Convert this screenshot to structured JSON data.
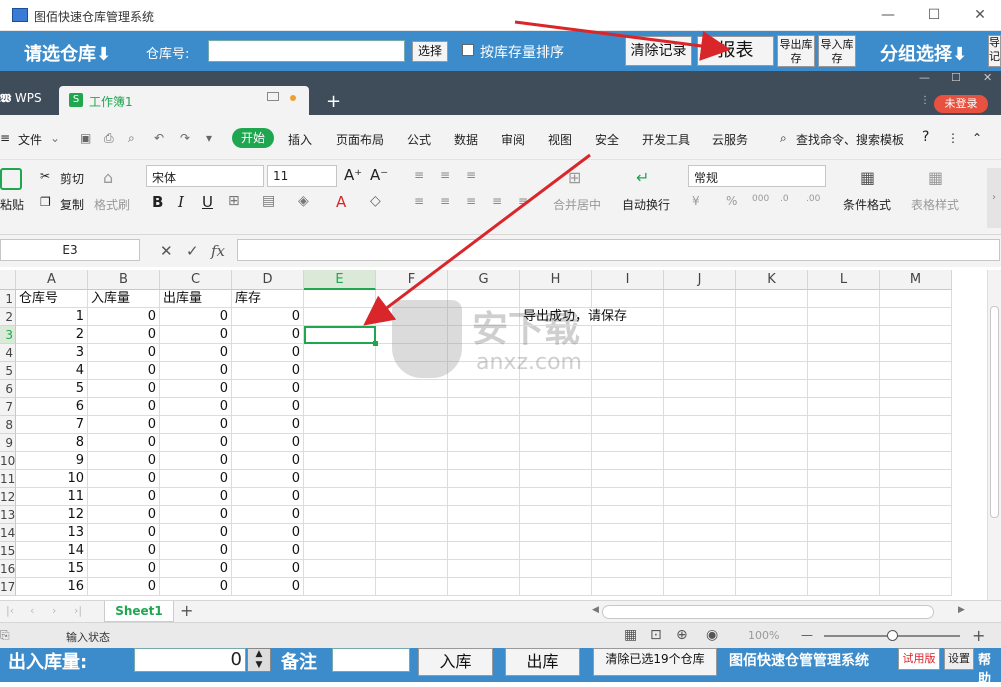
{
  "window": {
    "title": "图佰快速仓库管理系统",
    "min": "—",
    "max": "☐",
    "close": "✕"
  },
  "topbar": {
    "choose_warehouse": "请选仓库⬇",
    "warehouse_no_label": "仓库号:",
    "warehouse_no_value": "",
    "select_btn": "选择",
    "sort_checkbox_label": "按库存量排序",
    "clear_records": "清除记录",
    "report": "报表",
    "export_stock": "导出库存",
    "import_stock": "导入库存",
    "group_select": "分组选择⬇",
    "partial_btn": "导记"
  },
  "wps": {
    "app_tab": "WPS",
    "doc_tab": "工作簿1",
    "new_tab": "+",
    "login": "未登录"
  },
  "menu": {
    "file": "文件",
    "items": [
      "开始",
      "插入",
      "页面布局",
      "公式",
      "数据",
      "审阅",
      "视图",
      "安全",
      "开发工具",
      "云服务"
    ],
    "search": "查找命令、搜索模板",
    "help": "?"
  },
  "ribbon": {
    "paste": "粘贴",
    "cut": "剪切",
    "copy": "复制",
    "format_painter": "格式刷",
    "font": "宋体",
    "font_size": "11",
    "bold": "B",
    "italic": "I",
    "underline": "U",
    "merge_center": "合并居中",
    "wrap": "自动换行",
    "number_format": "常规",
    "cond_format": "条件格式",
    "table_style": "表格样式"
  },
  "formula": {
    "name_box": "E3",
    "fx": "fx",
    "content": ""
  },
  "sheet": {
    "columns": [
      "A",
      "B",
      "C",
      "D",
      "E",
      "F",
      "G",
      "H",
      "I",
      "J",
      "K",
      "L",
      "M"
    ],
    "row_numbers": [
      "1",
      "2",
      "3",
      "4",
      "5",
      "6",
      "7",
      "8",
      "9",
      "10",
      "11",
      "12",
      "13",
      "14",
      "15",
      "16",
      "17"
    ],
    "header_row": [
      "仓库号",
      "入库量",
      "出库量",
      "库存"
    ],
    "rows": [
      [
        "1",
        "0",
        "0",
        "0"
      ],
      [
        "2",
        "0",
        "0",
        "0"
      ],
      [
        "3",
        "0",
        "0",
        "0"
      ],
      [
        "4",
        "0",
        "0",
        "0"
      ],
      [
        "5",
        "0",
        "0",
        "0"
      ],
      [
        "6",
        "0",
        "0",
        "0"
      ],
      [
        "7",
        "0",
        "0",
        "0"
      ],
      [
        "8",
        "0",
        "0",
        "0"
      ],
      [
        "9",
        "0",
        "0",
        "0"
      ],
      [
        "10",
        "0",
        "0",
        "0"
      ],
      [
        "11",
        "0",
        "0",
        "0"
      ],
      [
        "12",
        "0",
        "0",
        "0"
      ],
      [
        "13",
        "0",
        "0",
        "0"
      ],
      [
        "14",
        "0",
        "0",
        "0"
      ],
      [
        "15",
        "0",
        "0",
        "0"
      ],
      [
        "16",
        "0",
        "0",
        "0"
      ]
    ],
    "message": "导出成功，请保存",
    "watermark_cn": "安下载",
    "watermark_en": "anxz.com"
  },
  "sheettabs": {
    "active": "Sheet1",
    "add": "+"
  },
  "status": {
    "input_state": "输入状态",
    "zoom": "100%",
    "minus": "—",
    "plus": "+"
  },
  "bottom": {
    "out_in_qty": "出入库量:",
    "qty_value": "0",
    "remark": "备注",
    "in_btn": "入库",
    "out_btn": "出库",
    "clear_selected": "清除已选19个仓库",
    "system_name": "图佰快速仓管管理系统",
    "trial": "试用版",
    "settings": "设置",
    "help": "帮助"
  },
  "colors": {
    "accent_blue": "#3c8ccb",
    "wps_dark": "#3f4c5a",
    "green": "#1ea74f",
    "arrow_red": "#d8262b",
    "login_red": "#e8513f"
  }
}
